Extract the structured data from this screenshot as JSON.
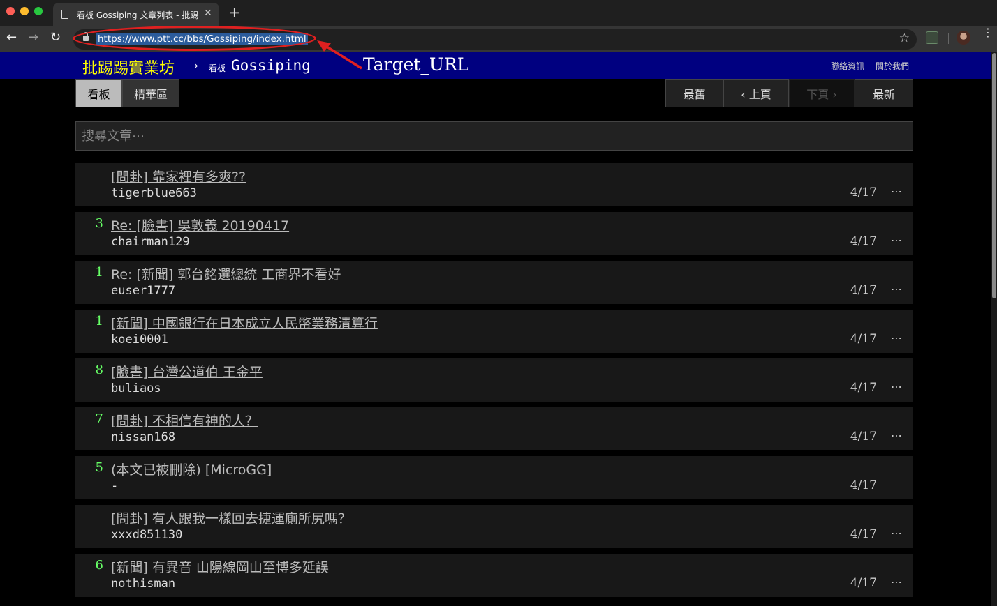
{
  "browser": {
    "tab_title": "看板 Gossiping 文章列表 - 批踢",
    "tab_close": "✕",
    "new_tab": "+",
    "url": "https://www.ptt.cc/bbs/Gossiping/index.html",
    "nav_back": "←",
    "nav_forward": "→",
    "nav_reload": "↻",
    "star": "☆",
    "menu": "⋮"
  },
  "annotation": {
    "label": "Target_URL",
    "color": "#e02020"
  },
  "header": {
    "site_name": "批踢踢實業坊",
    "crumb_sep": "›",
    "board_label": "看板",
    "board_name": "Gossiping",
    "links": [
      "聯絡資訊",
      "關於我們"
    ]
  },
  "actions": {
    "board": "看板",
    "digest": "精華區",
    "oldest": "最舊",
    "prev": "‹ 上頁",
    "next": "下頁 ›",
    "latest": "最新"
  },
  "search": {
    "placeholder": "搜尋文章⋯"
  },
  "articles": [
    {
      "nrec": "",
      "title": "[問卦] 靠家裡有多爽??",
      "author": "tigerblue663",
      "date": "4/17",
      "more": "⋯",
      "deleted": false
    },
    {
      "nrec": "3",
      "title": "Re: [臉書] 吳敦義 20190417",
      "author": "chairman129",
      "date": "4/17",
      "more": "⋯",
      "deleted": false
    },
    {
      "nrec": "1",
      "title": "Re: [新聞] 郭台銘選總統 工商界不看好",
      "author": "euser1777",
      "date": "4/17",
      "more": "⋯",
      "deleted": false
    },
    {
      "nrec": "1",
      "title": "[新聞] 中國銀行在日本成立人民幣業務清算行",
      "author": "koei0001",
      "date": "4/17",
      "more": "⋯",
      "deleted": false
    },
    {
      "nrec": "8",
      "title": "[臉書] 台灣公道伯 王金平",
      "author": "buliaos",
      "date": "4/17",
      "more": "⋯",
      "deleted": false
    },
    {
      "nrec": "7",
      "title": "[問卦] 不相信有神的人？",
      "author": "nissan168",
      "date": "4/17",
      "more": "⋯",
      "deleted": false
    },
    {
      "nrec": "5",
      "title": "(本文已被刪除) [MicroGG]",
      "author": "-",
      "date": "4/17",
      "more": "",
      "deleted": true
    },
    {
      "nrec": "",
      "title": "[問卦] 有人跟我一樣回去捷運廁所尻嗎？",
      "author": "xxxd851130",
      "date": "4/17",
      "more": "⋯",
      "deleted": false
    },
    {
      "nrec": "6",
      "title": "[新聞] 有異音 山陽線岡山至博多延誤",
      "author": "nothisman",
      "date": "4/17",
      "more": "⋯",
      "deleted": false
    }
  ]
}
